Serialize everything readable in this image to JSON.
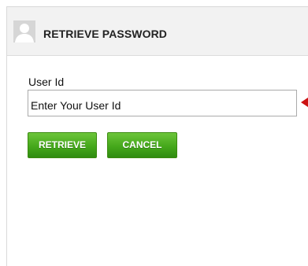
{
  "header": {
    "title": "RETRIEVE PASSWORD",
    "avatar_icon": "user-silhouette-icon"
  },
  "form": {
    "user_id_label": "User Id",
    "user_id_value": "Enter Your User Id",
    "pointer_icon": "red-arrow-left-icon"
  },
  "buttons": {
    "retrieve_label": "RETRIEVE",
    "cancel_label": "CANCEL"
  },
  "colors": {
    "button_green": "#45a81b",
    "arrow_red": "#cc1111",
    "header_bg": "#f2f2f2"
  }
}
